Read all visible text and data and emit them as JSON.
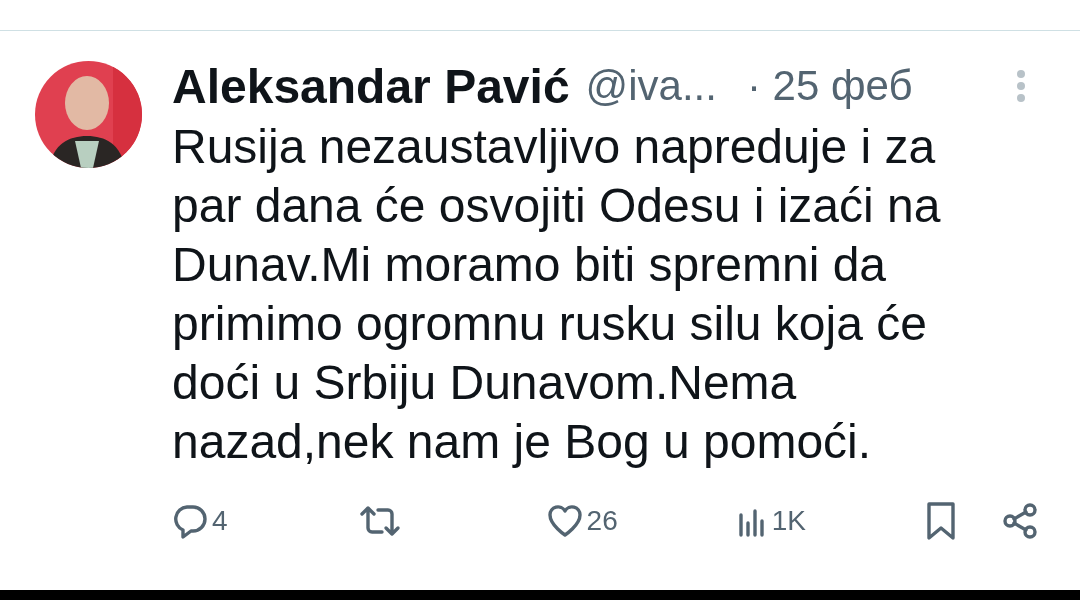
{
  "tweet": {
    "author": {
      "name": "Aleksandar Pavić",
      "handle": "@iva...",
      "time": "· 25 феб"
    },
    "text": "Rusija nezaustavljivo napreduje i za\npar dana će osvojiti Odesu i izaći na\nDunav.Mi moramo biti spremni da\nprimimo ogromnu rusku silu koja će\ndoći u Srbiju Dunavom.Nema\nnazad,nek nam je Bog u pomoći.",
    "actions": [
      {
        "kind": "reply",
        "count": "4"
      },
      {
        "kind": "retweet"
      },
      {
        "kind": "like",
        "count": "26"
      },
      {
        "kind": "views",
        "count": "1K"
      },
      {
        "kind": "bookmark"
      },
      {
        "kind": "share"
      }
    ]
  }
}
